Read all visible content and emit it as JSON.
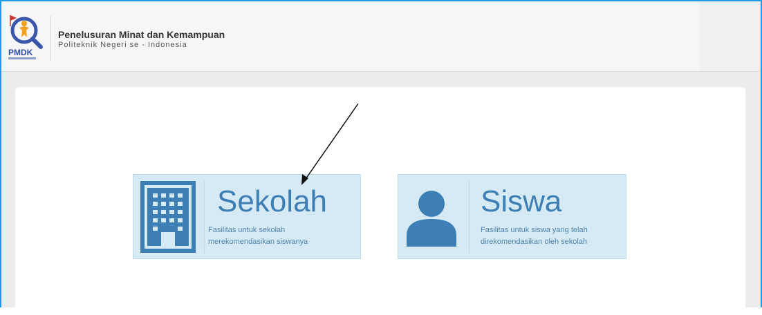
{
  "header": {
    "logo_text": "PMDK",
    "title": "Penelusuran Minat dan Kemampuan",
    "subtitle": "Politeknik Negeri se - Indonesia"
  },
  "options": [
    {
      "title": "Sekolah",
      "desc_line1": "Fasilitas untuk sekolah",
      "desc_line2": "merekomendasikan siswanya",
      "icon": "building-icon"
    },
    {
      "title": "Siswa",
      "desc_line1": "Fasilitas untuk siswa yang telah",
      "desc_line2": "direkomendasikan oleh sekolah",
      "icon": "user-icon"
    }
  ],
  "colors": {
    "accent": "#3d7fb4",
    "card_bg": "#d6eaf6",
    "frame": "#1e9be8"
  },
  "annotation": "arrow-pointing-to-sekolah"
}
